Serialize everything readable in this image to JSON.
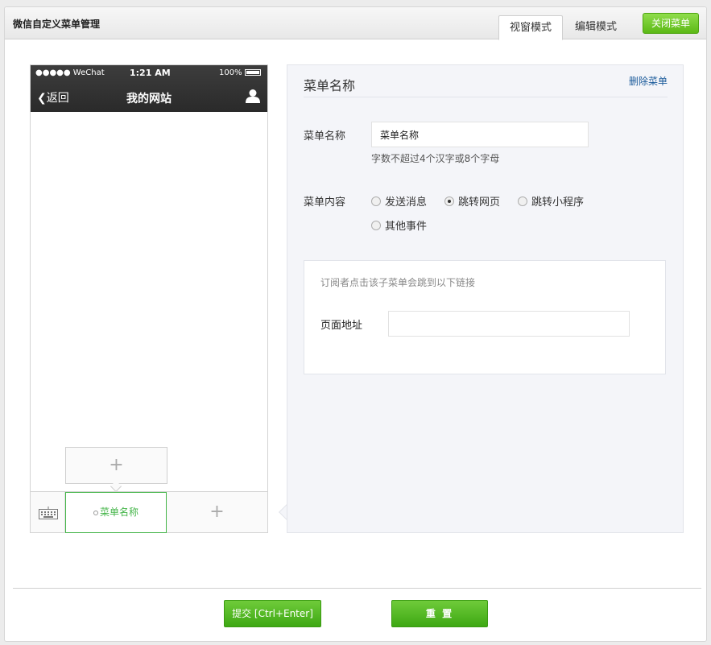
{
  "window": {
    "title": "微信自定义菜单管理",
    "tabs": [
      {
        "label": "视窗模式",
        "active": true
      },
      {
        "label": "编辑模式",
        "active": false
      }
    ],
    "close_label": "关闭菜单"
  },
  "phone": {
    "status": {
      "signal": "●●●●● WeChat",
      "time": "1:21 AM",
      "battery": "100%"
    },
    "back_label": "返回",
    "title": "我的网站",
    "add_sub_symbol": "+",
    "active_menu_label": "菜单名称",
    "add_menu_symbol": "+"
  },
  "editor": {
    "title": "菜单名称",
    "delete_label": "删除菜单",
    "name_label": "菜单名称",
    "name_value": "菜单名称",
    "name_hint": "字数不超过4个汉字或8个字母",
    "content_label": "菜单内容",
    "options": [
      {
        "label": "发送消息",
        "checked": false
      },
      {
        "label": "跳转网页",
        "checked": true
      },
      {
        "label": "跳转小程序",
        "checked": false
      },
      {
        "label": "其他事件",
        "checked": false
      }
    ],
    "link_tip": "订阅者点击该子菜单会跳到以下链接",
    "url_label": "页面地址",
    "url_value": ""
  },
  "footer": {
    "submit_label": "提交 [Ctrl+Enter]",
    "reset_label": "重 置"
  }
}
